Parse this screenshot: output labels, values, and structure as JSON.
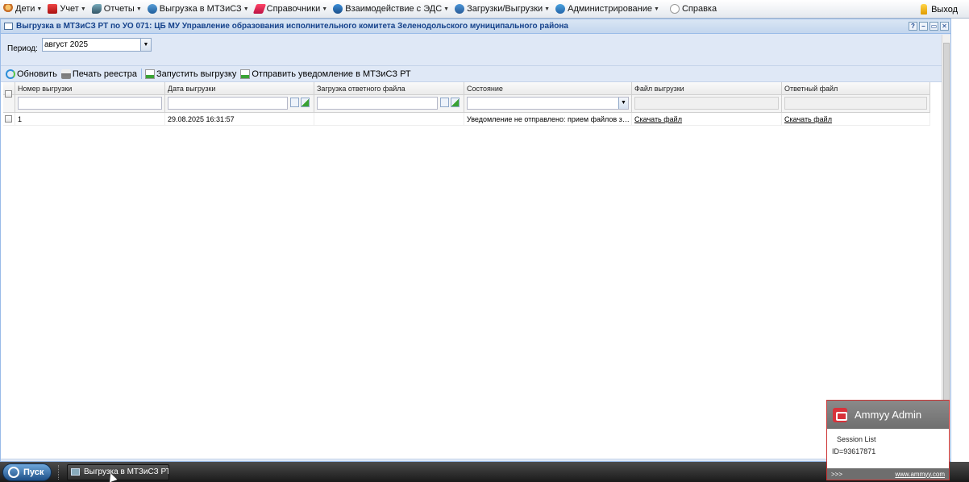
{
  "menu": {
    "items": [
      {
        "label": "Дети",
        "icon": "children-icon",
        "cls": "kids"
      },
      {
        "label": "Учет",
        "icon": "accounting-icon",
        "cls": "acc"
      },
      {
        "label": "Отчеты",
        "icon": "reports-icon",
        "cls": "rep"
      },
      {
        "label": "Выгрузка в МТЗиСЗ",
        "icon": "export-icon",
        "cls": "exp"
      },
      {
        "label": "Справочники",
        "icon": "references-icon",
        "cls": "ref"
      },
      {
        "label": "Взаимодействие с ЭДС",
        "icon": "eds-icon",
        "cls": "eds"
      },
      {
        "label": "Загрузки/Выгрузки",
        "icon": "upload-download-icon",
        "cls": "load"
      },
      {
        "label": "Администрирование",
        "icon": "admin-icon",
        "cls": "adm"
      }
    ],
    "help_label": "Справка",
    "exit_label": "Выход"
  },
  "window": {
    "title": "Выгрузка в МТЗиСЗ РТ по УО 071: ЦБ МУ Управление образования исполнительного комитета Зеленодольского муниципального района",
    "tools": [
      "?",
      "–",
      "▭",
      "✕"
    ]
  },
  "period": {
    "label": "Период:",
    "value": "август 2025"
  },
  "toolbar": {
    "refresh_label": "Обновить",
    "print_label": "Печать реестра",
    "start_label": "Запустить выгрузку",
    "send_label": "Отправить уведомление в МТЗиСЗ РТ"
  },
  "grid": {
    "columns": [
      "Номер выгрузки",
      "Дата выгрузки",
      "Загрузка ответного файла",
      "Состояние",
      "Файл выгрузки",
      "Ответный файл"
    ],
    "rows": [
      {
        "number": "1",
        "date": "29.08.2025 16:31:57",
        "response_upload": "",
        "state": "Уведомление не отправлено: прием файлов закр...",
        "export_file": "Скачать файл",
        "response_file": "Скачать файл"
      }
    ]
  },
  "taskbar": {
    "start_label": "Пуск",
    "task_label": "Выгрузка в МТЗиСЗ РТ п..."
  },
  "ammyy": {
    "title": "Ammyy Admin",
    "session_list": "Session List",
    "id_text": "ID=93617871",
    "more": ">>>",
    "site": "www.ammyy.com"
  },
  "colors": {
    "header_blue": "#15428b",
    "panel_bg": "#dfe8f6",
    "ammyy_border": "#cc3333"
  }
}
